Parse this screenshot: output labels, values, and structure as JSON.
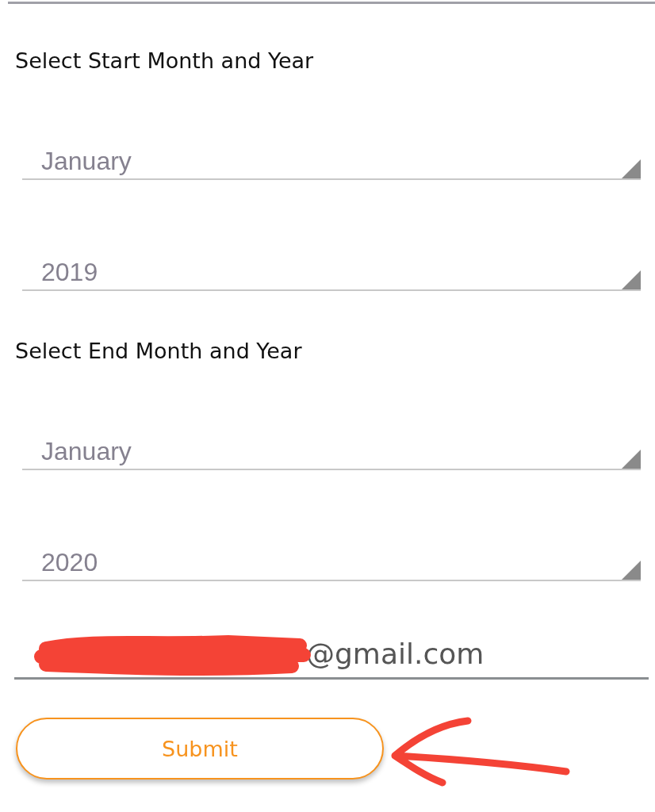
{
  "sections": [
    {
      "label": "Select Start Month and Year",
      "dropdowns": [
        {
          "value": "January"
        },
        {
          "value": "2019"
        }
      ]
    },
    {
      "label": "Select End Month and Year",
      "dropdowns": [
        {
          "value": "January"
        },
        {
          "value": "2020"
        }
      ]
    }
  ],
  "email": {
    "value": "@gmail.com",
    "redacted": true
  },
  "submit": {
    "label": "Submit"
  },
  "annotation": {
    "kind": "arrow"
  }
}
